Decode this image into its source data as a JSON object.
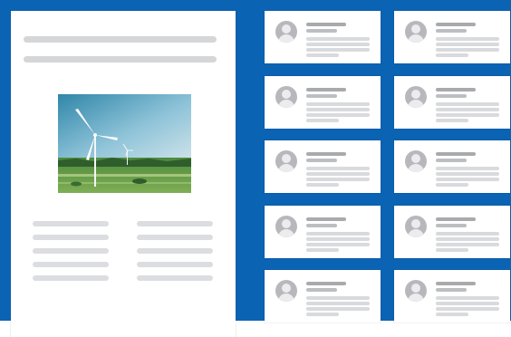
{
  "colors": {
    "background": "#0b63b3",
    "panel": "#ffffff",
    "placeholder_dark": "#a9aaad",
    "placeholder_mid": "#bdbec1",
    "placeholder_light": "#d9dadd",
    "avatar": "#b7b8bb"
  },
  "document": {
    "image": {
      "subject": "wind-turbines-landscape"
    },
    "heading_line_count": 2,
    "text_columns": 2,
    "lines_per_column": 5
  },
  "cards": {
    "icon": "user-avatar-icon",
    "rows": 5,
    "columns": 2
  }
}
